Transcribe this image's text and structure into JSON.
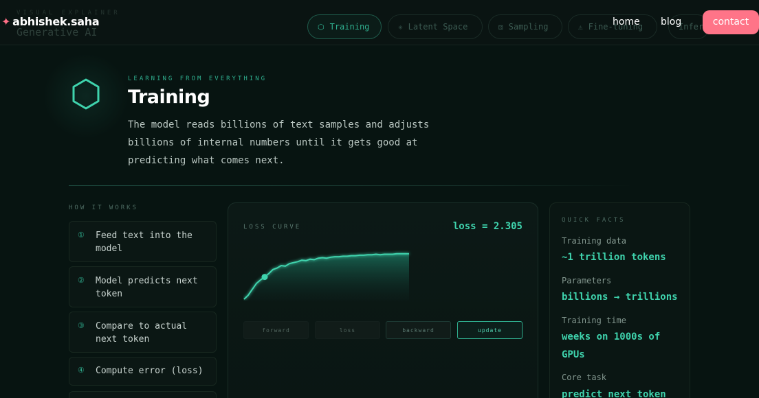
{
  "header": {
    "brand_star": "✦",
    "brand_name": "abhishek.saha",
    "ghost_kicker": "VISUAL EXPLAINER",
    "ghost_title": "Generative AI",
    "tabs": [
      {
        "icon": "⬡",
        "label": "Training",
        "active": true
      },
      {
        "icon": "✳",
        "label": "Latent Space",
        "active": false
      },
      {
        "icon": "⚄",
        "label": "Sampling",
        "active": false
      },
      {
        "icon": "⚠",
        "label": "Fine-tuning",
        "active": false
      },
      {
        "icon": "",
        "label": "Inference",
        "active": false
      }
    ],
    "nav": {
      "home": "home",
      "blog": "blog",
      "contact": "contact"
    }
  },
  "hero": {
    "icon": "hexagon-icon",
    "kicker": "LEARNING FROM EVERYTHING",
    "title": "Training",
    "subtitle": "The model reads billions of text samples and adjusts billions of internal numbers until it gets good at predicting what comes next."
  },
  "how_it_works": {
    "label": "HOW IT WORKS",
    "steps": [
      {
        "num": "①",
        "text": "Feed text into the model"
      },
      {
        "num": "②",
        "text": "Model predicts next token"
      },
      {
        "num": "③",
        "text": "Compare to actual next token"
      },
      {
        "num": "④",
        "text": "Compute error (loss)"
      }
    ]
  },
  "loss_panel": {
    "label": "LOSS CURVE",
    "value_text": "loss = 2.305",
    "phases": [
      "forward",
      "loss",
      "backward",
      "update"
    ],
    "active_phase": "update",
    "accent_color": "#3fd3ad"
  },
  "chart_data": {
    "type": "area",
    "title": "LOSS CURVE",
    "xlabel": "",
    "ylabel": "",
    "series": [
      {
        "values": [
          0.0,
          0.08,
          0.2,
          0.32,
          0.39,
          0.45,
          0.52,
          0.6,
          0.63,
          0.68,
          0.67,
          0.72,
          0.74,
          0.76,
          0.79,
          0.78,
          0.81,
          0.8,
          0.83,
          0.84,
          0.83,
          0.85,
          0.86,
          0.86,
          0.87,
          0.87,
          0.88,
          0.88,
          0.89,
          0.89,
          0.9,
          0.9,
          0.91,
          0.9,
          0.91,
          0.91,
          0.91,
          0.92,
          0.92,
          0.92,
          0.92
        ]
      }
    ],
    "highlight_index": 5,
    "ylim": [
      0,
      1
    ],
    "grid": false
  },
  "quick_facts": {
    "label": "QUICK FACTS",
    "items": [
      {
        "label": "Training data",
        "value": "~1 trillion tokens"
      },
      {
        "label": "Parameters",
        "value": "billions → trillions"
      },
      {
        "label": "Training time",
        "value": "weeks on 1000s of GPUs"
      },
      {
        "label": "Core task",
        "value": "predict next token"
      }
    ]
  }
}
